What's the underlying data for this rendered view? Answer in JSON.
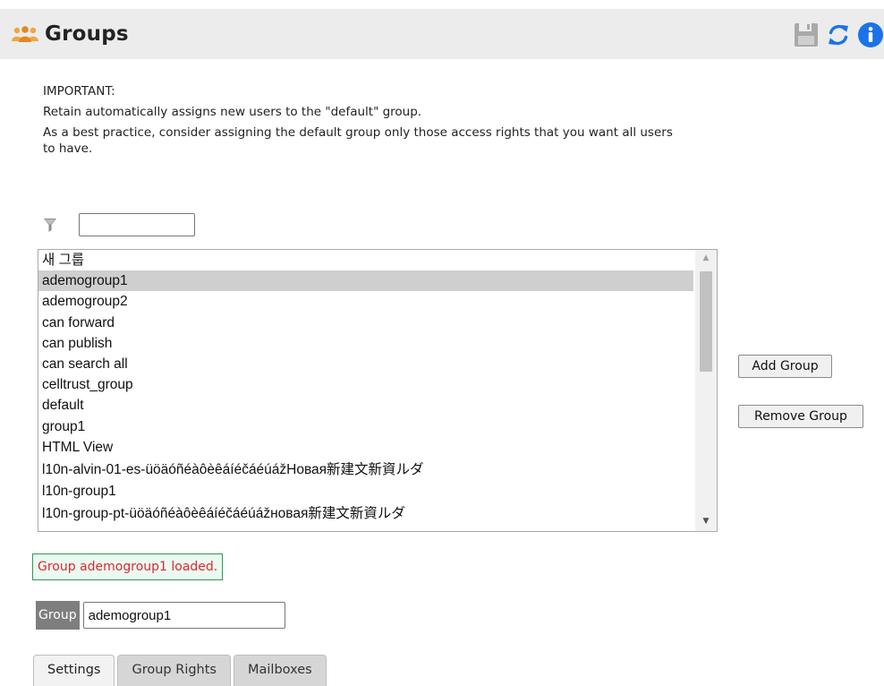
{
  "header": {
    "title": "Groups",
    "icons": [
      "users-icon",
      "save-icon",
      "refresh-icon",
      "info-icon"
    ]
  },
  "notice": {
    "heading": "IMPORTANT:",
    "line1": "Retain automatically assigns new users to the \"default\" group.",
    "line2": "As a best practice, consider assigning the default group only those access rights that you want all users to have."
  },
  "filter": {
    "icon": "filter-icon",
    "value": ""
  },
  "group_list": {
    "selected_index": 1,
    "items": [
      "새 그룹",
      "ademogroup1",
      "ademogroup2",
      "can forward",
      "can publish",
      "can search all",
      "celltrust_group",
      "default",
      "group1",
      "HTML View",
      "l10n-alvin-01-es-üöäóñéàôèêáíéčáéúážНовая新建文新資ルダ",
      "l10n-group1",
      "l10n-group-pt-üöäóñéàôèêáíéčáéúážновая新建文新資ルダ"
    ]
  },
  "buttons": {
    "add_group": "Add Group",
    "remove_group": "Remove Group"
  },
  "status": {
    "message": "Group ademogroup1 loaded.",
    "color": "#e0282f"
  },
  "group_field": {
    "label": "Group",
    "value": "ademogroup1"
  },
  "tabs": [
    {
      "label": "Settings",
      "active": true
    },
    {
      "label": "Group Rights",
      "active": false
    },
    {
      "label": "Mailboxes",
      "active": false
    }
  ],
  "colors": {
    "accent_blue": "#1a73e8",
    "header_bg": "#ececec",
    "selection_bg": "#cfcfcf",
    "status_border": "#2e9a52"
  }
}
